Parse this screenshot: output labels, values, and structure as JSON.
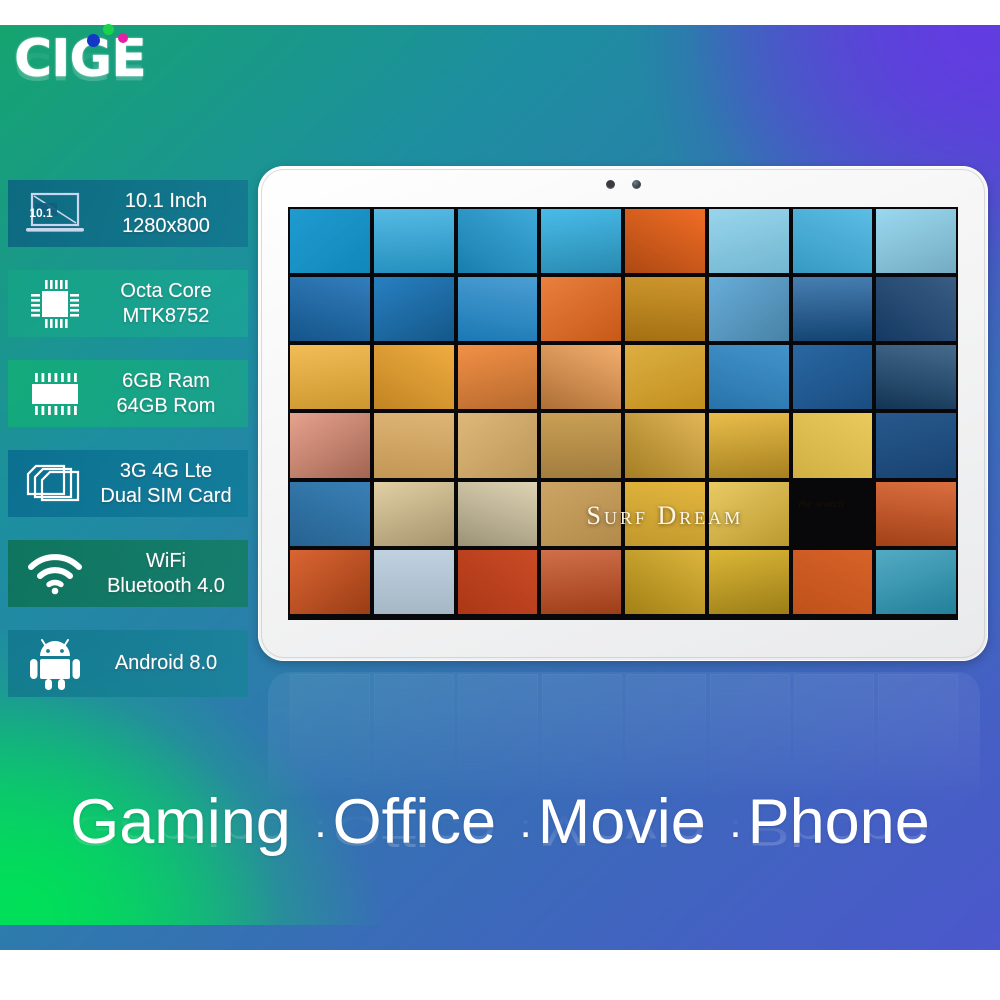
{
  "brand": {
    "logo_text": "CIGE",
    "dots": [
      "blue",
      "green",
      "magenta"
    ],
    "dot_colors": [
      "#1338C8",
      "#19D44B",
      "#E81FA5"
    ]
  },
  "background": {
    "gradient_from": "#04D459",
    "gradient_mid": "#1D8EA0",
    "gradient_to": "#5540D0"
  },
  "specs": [
    {
      "icon": "monitor-icon",
      "icon_label": "10.1",
      "line1": "10.1 Inch",
      "line2": "1280x800"
    },
    {
      "icon": "cpu-chip-icon",
      "line1": "Octa Core",
      "line2": "MTK8752"
    },
    {
      "icon": "memory-chip-icon",
      "line1": "6GB Ram",
      "line2": "64GB Rom"
    },
    {
      "icon": "sim-card-icon",
      "line1": "3G 4G Lte",
      "line2": "Dual SIM Card"
    },
    {
      "icon": "wifi-icon",
      "line1": "WiFi",
      "line2": "Bluetooth 4.0"
    },
    {
      "icon": "android-robot-icon",
      "line1": "Android 8.0",
      "line2": ""
    }
  ],
  "tablet": {
    "camera_icon": "front-camera-icon",
    "sensor_icon": "light-sensor-icon",
    "wallpaper_title": "Surf Dream",
    "wallpaper_mark": "the search",
    "mosaic": {
      "columns": 8,
      "rows": 6,
      "tiles": [
        "#1396CE",
        "#2BA8DE",
        "#1E9BD4",
        "#34B4E6",
        "#F0651A",
        "#7FCBE8",
        "#3FB3E2",
        "#8FD4EE",
        "#1B6FB5",
        "#1C79BE",
        "#1E86C8",
        "#E8681C",
        "#C98A16",
        "#5FA9D8",
        "#1A5E9E",
        "#17406E",
        "#F0B138",
        "#EEA32B",
        "#F08A3C",
        "#F09A4A",
        "#D7A021",
        "#2E87C6",
        "#1F5F9E",
        "#17456F",
        "#E08C72",
        "#D9A85E",
        "#DBB069",
        "#C79A4C",
        "#D8A42E",
        "#E6B22C",
        "#E8C44A",
        "#1C4F86",
        "#2F79B2",
        "#D9C38E",
        "#D8CBA6",
        "#C69A52",
        "#E2B234",
        "#E5BD3C",
        "#D4551E",
        "#D6541C",
        "#B9CCDC",
        "#C8411A",
        "#C34C1E",
        "#D5A81B",
        "#D7AE20",
        "#D45A1D",
        "#2896B4",
        "#2490B0"
      ]
    }
  },
  "tagline": {
    "items": [
      "Gaming",
      "Office",
      "Movie",
      "Phone"
    ],
    "separator": "."
  }
}
